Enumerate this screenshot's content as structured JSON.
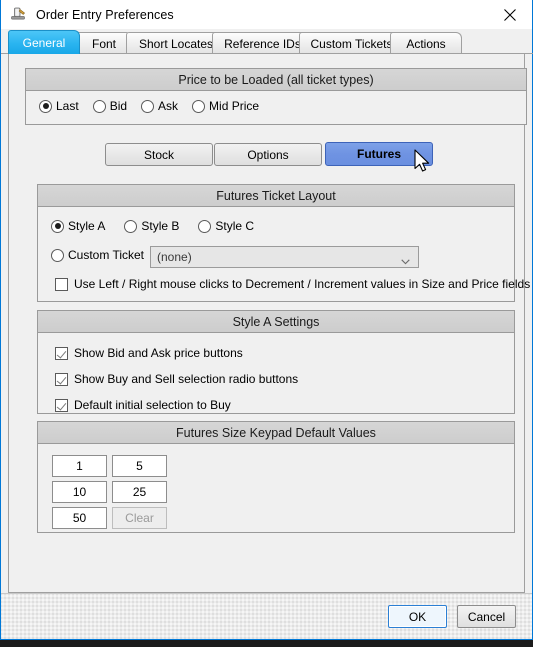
{
  "window": {
    "title": "Order Entry Preferences",
    "icon": "gavel-icon",
    "close_label": "✕"
  },
  "tabs": [
    {
      "label": "General",
      "selected": true
    },
    {
      "label": "Font",
      "selected": false
    },
    {
      "label": "Short Locates",
      "selected": false
    },
    {
      "label": "Reference IDs",
      "selected": false
    },
    {
      "label": "Custom Tickets",
      "selected": false
    },
    {
      "label": "Actions",
      "selected": false
    }
  ],
  "price_group": {
    "title": "Price to be Loaded (all ticket types)",
    "options": [
      {
        "label": "Last",
        "selected": true
      },
      {
        "label": "Bid",
        "selected": false
      },
      {
        "label": "Ask",
        "selected": false
      },
      {
        "label": "Mid Price",
        "selected": false
      }
    ]
  },
  "ticket_type_buttons": [
    {
      "label": "Stock",
      "active": false
    },
    {
      "label": "Options",
      "active": false
    },
    {
      "label": "Futures",
      "active": true
    }
  ],
  "layout_group": {
    "title": "Futures Ticket Layout",
    "styles": [
      {
        "label": "Style A",
        "selected": true
      },
      {
        "label": "Style B",
        "selected": false
      },
      {
        "label": "Style C",
        "selected": false
      }
    ],
    "custom_ticket": {
      "label": "Custom Ticket",
      "selected": false
    },
    "custom_ticket_combo": {
      "value": "(none)",
      "chevron": "chevron-down-icon"
    },
    "mouse_clicks_checkbox": {
      "label": "Use Left / Right  mouse clicks to Decrement / Increment  values in Size and Price fields",
      "checked": false
    }
  },
  "style_a_group": {
    "title": "Style A Settings",
    "checkboxes": [
      {
        "label": "Show Bid and Ask price buttons",
        "checked": true
      },
      {
        "label": "Show Buy and Sell selection radio buttons",
        "checked": true
      },
      {
        "label": "Default initial selection to Buy",
        "checked": true
      }
    ]
  },
  "keypad_group": {
    "title": "Futures Size Keypad Default Values",
    "cells": [
      {
        "value": "1",
        "disabled": false
      },
      {
        "value": "5",
        "disabled": false
      },
      {
        "value": "10",
        "disabled": false
      },
      {
        "value": "25",
        "disabled": false
      },
      {
        "value": "50",
        "disabled": false
      },
      {
        "value": "Clear",
        "disabled": true
      }
    ]
  },
  "footer": {
    "ok_label": "OK",
    "cancel_label": "Cancel"
  },
  "colors": {
    "accent_tab": "#2ab4f0",
    "accent_button": "#6f93e2",
    "window_border": "#0078d7",
    "group_header": "#d2d2d2"
  }
}
